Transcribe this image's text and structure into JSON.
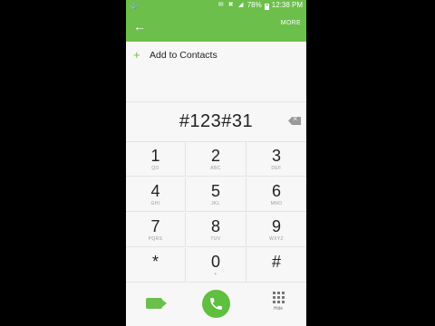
{
  "status": {
    "time": "12:38 PM",
    "battery": "78%"
  },
  "header": {
    "more_label": "MORE"
  },
  "add_contact": {
    "label": "Add to Contacts"
  },
  "dialer": {
    "number": "#123#31"
  },
  "keys": [
    {
      "digit": "1",
      "letters": "QO"
    },
    {
      "digit": "2",
      "letters": "ABC"
    },
    {
      "digit": "3",
      "letters": "DEF"
    },
    {
      "digit": "4",
      "letters": "GHI"
    },
    {
      "digit": "5",
      "letters": "JKL"
    },
    {
      "digit": "6",
      "letters": "MNO"
    },
    {
      "digit": "7",
      "letters": "PQRS"
    },
    {
      "digit": "8",
      "letters": "TUV"
    },
    {
      "digit": "9",
      "letters": "WXYZ"
    },
    {
      "digit": "*",
      "letters": ""
    },
    {
      "digit": "0",
      "letters": "+"
    },
    {
      "digit": "#",
      "letters": ""
    }
  ],
  "bottom": {
    "hide_label": "Hide"
  },
  "colors": {
    "accent": "#6cbf4a",
    "call": "#5fbf3f"
  },
  "icons": [
    "back-arrow-icon",
    "plus-icon",
    "backspace-icon",
    "video-call-icon",
    "phone-icon",
    "dialpad-icon"
  ]
}
